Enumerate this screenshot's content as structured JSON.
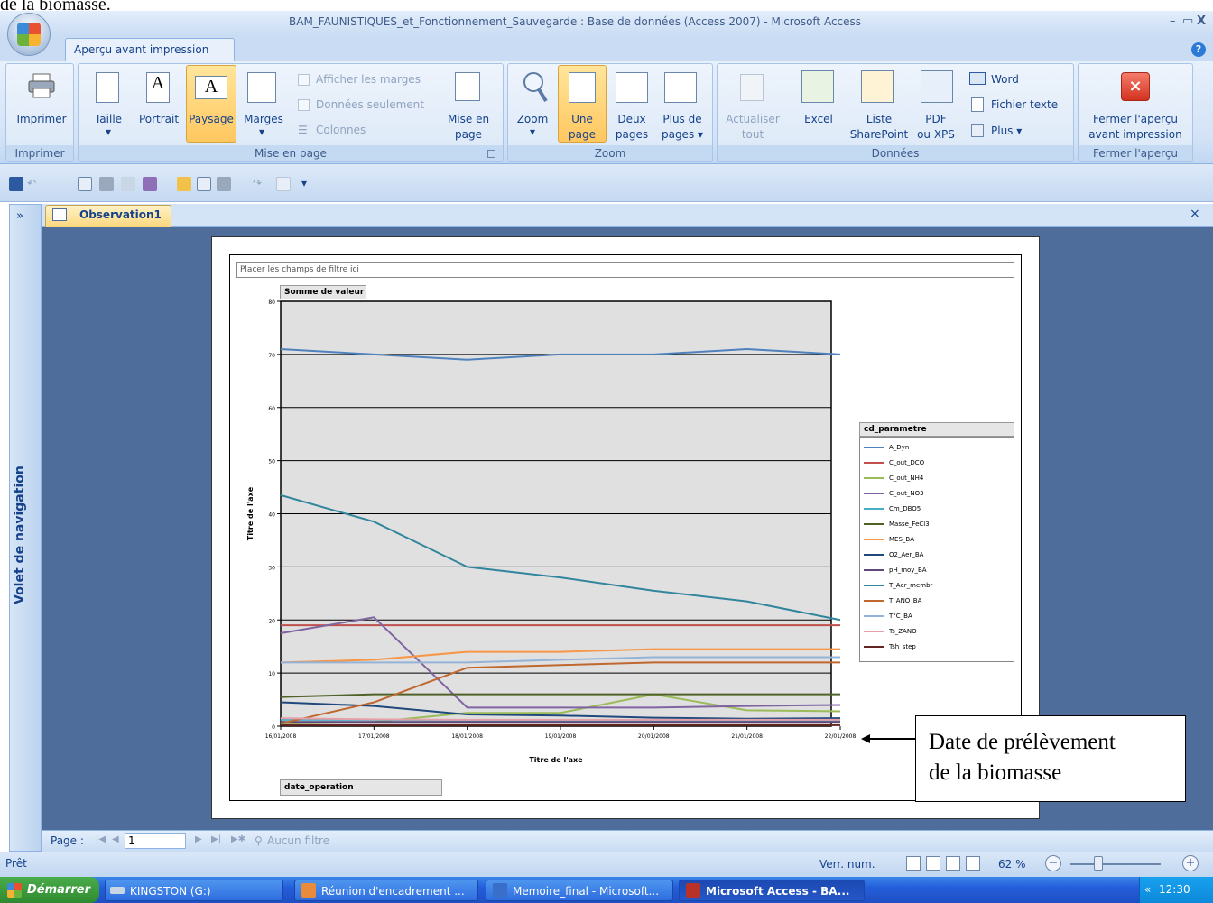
{
  "doc_top_text": "de la biomasse.",
  "window": {
    "title": "BAM_FAUNISTIQUES_et_Fonctionnement_Sauvegarde : Base de données (Access 2007) - Microsoft Access",
    "minimize": "–",
    "restore": "▭",
    "close": "X"
  },
  "ribbon": {
    "tab": "Aperçu avant impression",
    "help": "?",
    "groups": {
      "imprimer": {
        "label": "Imprimer",
        "btn": "Imprimer"
      },
      "mise_en_page": {
        "label": "Mise en page",
        "taille": "Taille",
        "portrait": "Portrait",
        "paysage": "Paysage",
        "marges": "Marges",
        "afficher_marges": "Afficher les marges",
        "donnees_seulement": "Données seulement",
        "colonnes": "Colonnes",
        "mise_en_page_l1": "Mise en",
        "mise_en_page_l2": "page"
      },
      "zoom": {
        "label": "Zoom",
        "zoom": "Zoom",
        "une_l1": "Une",
        "une_l2": "page",
        "deux_l1": "Deux",
        "deux_l2": "pages",
        "plus_l1": "Plus de",
        "plus_l2": "pages ▾"
      },
      "donnees": {
        "label": "Données",
        "actualiser_l1": "Actualiser",
        "actualiser_l2": "tout",
        "excel": "Excel",
        "liste_l1": "Liste",
        "liste_l2": "SharePoint",
        "pdf_l1": "PDF",
        "pdf_l2": "ou XPS",
        "word": "Word",
        "fichier_texte": "Fichier texte",
        "plus": "Plus ▾"
      },
      "fermer": {
        "label": "Fermer l'aperçu",
        "btn_l1": "Fermer l'aperçu",
        "btn_l2": "avant impression"
      }
    }
  },
  "nav_pane": {
    "label": "Volet de navigation",
    "expand": "»"
  },
  "document_tab": {
    "label": "Observation1",
    "close": "×"
  },
  "pivot": {
    "filter_placeholder": "Placer les champs de filtre ici",
    "value_field": "Somme de valeur",
    "x_field": "date_operation",
    "legend_title": "cd_parametre"
  },
  "chart_data": {
    "type": "line",
    "ylabel": "Titre de l'axe",
    "xlabel": "Titre de l'axe",
    "ylim": [
      0,
      80
    ],
    "yticks": [
      "0",
      "10",
      "20",
      "30",
      "40",
      "50",
      "60",
      "70",
      "80"
    ],
    "categories": [
      "16/01/2008",
      "17/01/2008",
      "18/01/2008",
      "19/01/2008",
      "20/01/2008",
      "21/01/2008",
      "22/01/2008"
    ],
    "grid": true,
    "legend_position": "right",
    "series": [
      {
        "name": "A_Dyn",
        "color": "#4f81bd",
        "values": [
          71,
          70,
          69,
          70,
          70,
          71,
          70
        ]
      },
      {
        "name": "C_out_DCO",
        "color": "#c0504d",
        "values": [
          19,
          19,
          19,
          19,
          19,
          19,
          19
        ]
      },
      {
        "name": "C_out_NH4",
        "color": "#9bbb59",
        "values": [
          0.5,
          0.8,
          2.5,
          2.5,
          6,
          3,
          2.8
        ]
      },
      {
        "name": "C_out_NO3",
        "color": "#8064a2",
        "values": [
          17.5,
          20.5,
          3.5,
          3.5,
          3.5,
          3.8,
          4
        ]
      },
      {
        "name": "Cm_DBO5",
        "color": "#4bacc6",
        "values": [
          1.2,
          1.2,
          1.1,
          1.1,
          1.1,
          1.1,
          1.1
        ]
      },
      {
        "name": "Masse_FeCl3",
        "color": "#4f6228",
        "values": [
          5.5,
          6,
          6,
          6,
          6,
          6,
          6
        ]
      },
      {
        "name": "MES_BA",
        "color": "#f79646",
        "values": [
          12,
          12.5,
          14,
          14,
          14.5,
          14.5,
          14.5
        ]
      },
      {
        "name": "O2_Aer_BA",
        "color": "#1f497d",
        "values": [
          4.5,
          3.8,
          2.2,
          2,
          1.6,
          1.4,
          1.5
        ]
      },
      {
        "name": "pH_moy_BA",
        "color": "#5f497a",
        "values": [
          0.8,
          0.8,
          0.8,
          0.8,
          0.8,
          0.8,
          0.8
        ]
      },
      {
        "name": "T_Aer_membr",
        "color": "#31859c",
        "values": [
          43.5,
          38.5,
          30,
          28,
          25.5,
          23.5,
          20
        ]
      },
      {
        "name": "T_ANO_BA",
        "color": "#c0672f",
        "values": [
          0.5,
          4.5,
          11,
          11.5,
          12,
          12,
          12
        ]
      },
      {
        "name": "T°C_BA",
        "color": "#95b3d7",
        "values": [
          12,
          12,
          12,
          12.5,
          13,
          13,
          13
        ]
      },
      {
        "name": "Ts_ZANO",
        "color": "#e6a1a8",
        "values": [
          1.5,
          1.3,
          1.2,
          1.2,
          1.2,
          1.2,
          1.2
        ]
      },
      {
        "name": "Tsh_step",
        "color": "#632523",
        "values": [
          0.2,
          0.2,
          0.2,
          0.2,
          0.2,
          0.2,
          0.2
        ]
      }
    ]
  },
  "annotation": {
    "line1": "Date de prélèvement",
    "line2": "de la biomasse"
  },
  "page_nav": {
    "label": "Page :",
    "value": "1",
    "filter": "Aucun filtre"
  },
  "status": {
    "text": "Prêt",
    "numlock": "Verr. num.",
    "zoom": "62 %"
  },
  "taskbar": {
    "start": "Démarrer",
    "items": [
      "KINGSTON (G:)",
      "Réunion d'encadrement ...",
      "Memoire_final - Microsoft...",
      "Microsoft Access - BA..."
    ],
    "clock": "12:30",
    "tray_arrow": "«"
  }
}
